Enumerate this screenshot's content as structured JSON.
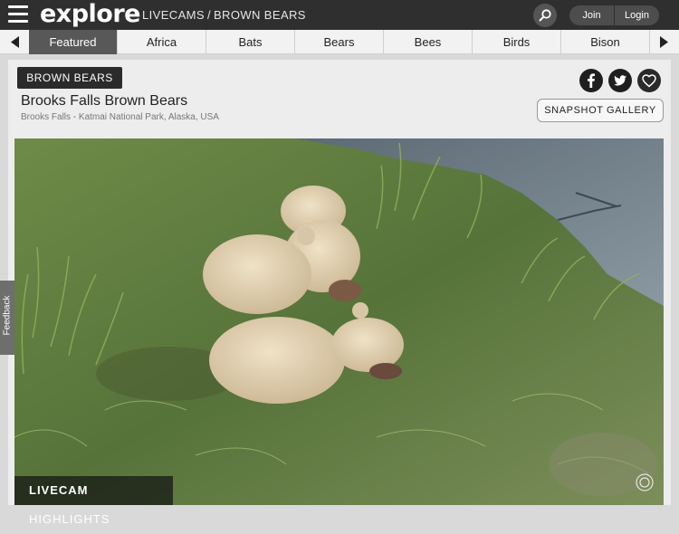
{
  "header": {
    "logo": "explore",
    "breadcrumb": [
      "LIVECAMS",
      "/",
      "BROWN BEARS"
    ],
    "join_label": "Join",
    "login_label": "Login"
  },
  "nav": {
    "tabs": [
      "Featured",
      "Africa",
      "Bats",
      "Bears",
      "Bees",
      "Birds",
      "Bison"
    ],
    "active_tab": "Featured"
  },
  "cam": {
    "tag": "BROWN BEARS",
    "title": "Brooks Falls Brown Bears",
    "location": "Brooks Falls - Katmai National Park, Alaska, USA",
    "gallery_button": "SNAPSHOT GALLERY"
  },
  "video": {
    "overlay_bold": "LIVECAM",
    "overlay_text": " HIGHLIGHTS",
    "watermark": "explore"
  },
  "feedback": {
    "label": "Feedback"
  },
  "colors": {
    "topbar": "#2f2f2f",
    "active_tab": "#585858",
    "panel": "#ededed",
    "grass": "#5f7b3c",
    "water": "#6e7f8c"
  }
}
